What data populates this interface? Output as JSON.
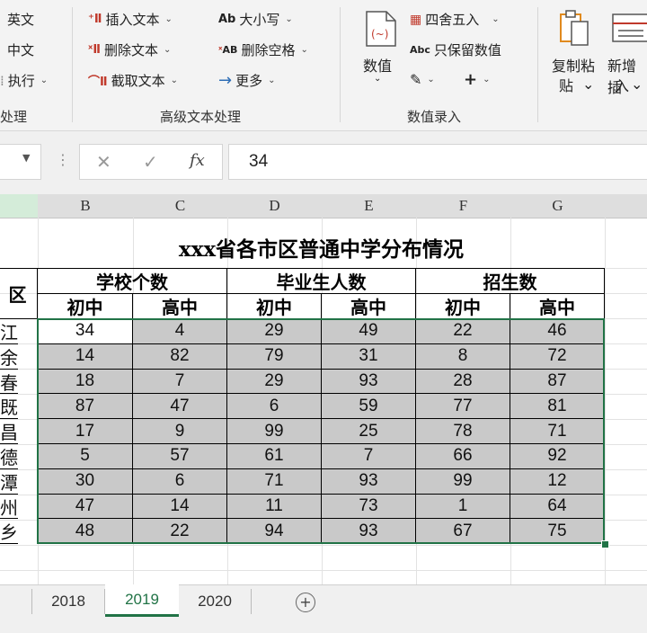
{
  "ribbon": {
    "group1": {
      "items": [
        "英文",
        "中文",
        "执行"
      ],
      "label": "处理"
    },
    "group2": {
      "items": [
        "插入文本",
        "删除文本",
        "截取文本",
        "大小写",
        "删除空格",
        "更多"
      ],
      "icons": {
        "case": "Ab",
        "trim": "AB"
      },
      "label": "高级文本处理"
    },
    "group3": {
      "big_button": "数值",
      "items": [
        "四舍五入",
        "只保留数值"
      ],
      "icons": {
        "keep_numbers": "Abc"
      },
      "plus": "+",
      "label": "数值录入"
    },
    "group4": {
      "copy_paste": [
        "复制粘",
        "贴"
      ],
      "new_insert": [
        "新增插",
        "入"
      ]
    }
  },
  "formula_bar": {
    "value": "34",
    "fx": "fx"
  },
  "sheet": {
    "columns": [
      "B",
      "C",
      "D",
      "E",
      "F",
      "G"
    ],
    "title": "xxx省各市区普通中学分布情况",
    "region_header": "区",
    "group_headers": [
      "学校个数",
      "毕业生人数",
      "招生数"
    ],
    "sub_headers": [
      "初中",
      "高中",
      "初中",
      "高中",
      "初中",
      "高中"
    ],
    "region_fragments": [
      "江",
      "余",
      "春",
      "既",
      "昌",
      "德",
      "潭",
      "州",
      "乡"
    ],
    "rows": [
      [
        "34",
        "4",
        "29",
        "49",
        "22",
        "46"
      ],
      [
        "14",
        "82",
        "79",
        "31",
        "8",
        "72"
      ],
      [
        "18",
        "7",
        "29",
        "93",
        "28",
        "87"
      ],
      [
        "87",
        "47",
        "6",
        "59",
        "77",
        "81"
      ],
      [
        "17",
        "9",
        "99",
        "25",
        "78",
        "71"
      ],
      [
        "5",
        "57",
        "61",
        "7",
        "66",
        "92"
      ],
      [
        "30",
        "6",
        "71",
        "93",
        "99",
        "12"
      ],
      [
        "47",
        "14",
        "11",
        "73",
        "1",
        "64"
      ],
      [
        "48",
        "22",
        "94",
        "93",
        "67",
        "75"
      ]
    ]
  },
  "tabs": {
    "items": [
      "2018",
      "2019",
      "2020"
    ],
    "active": "2019",
    "add": "+"
  },
  "colors": {
    "selection": "#c9c9c9",
    "selection_border": "#217346",
    "active_tab_text": "#217346",
    "header_bg": "#dedede"
  }
}
